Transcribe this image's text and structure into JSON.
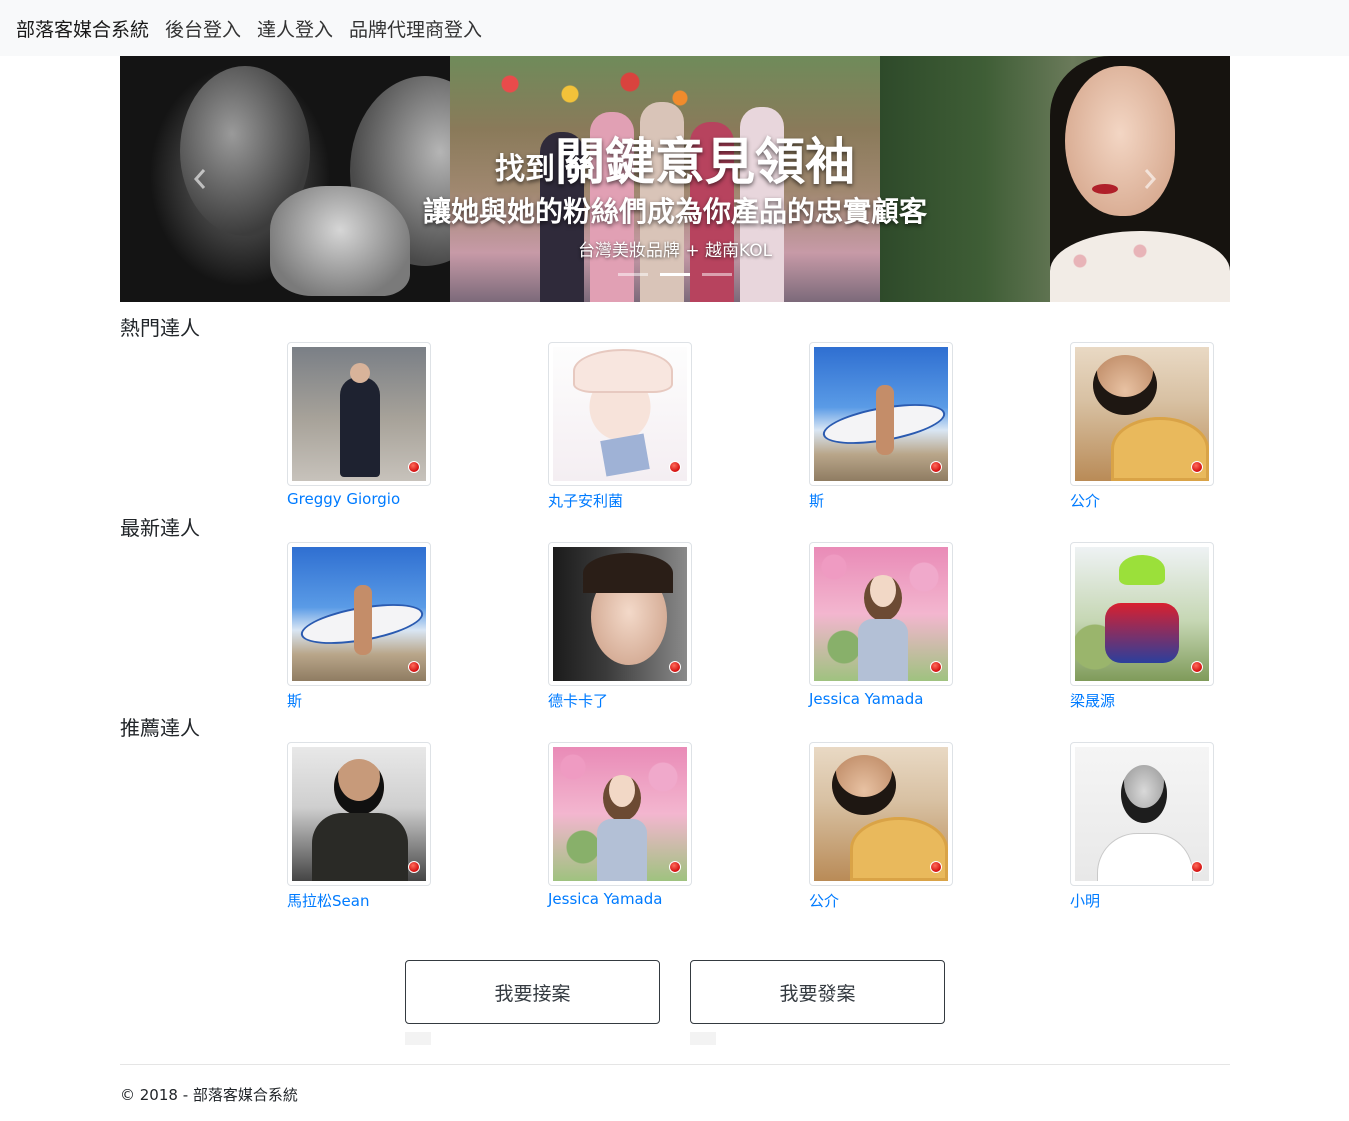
{
  "navbar": {
    "brand": "部落客媒合系統",
    "links": [
      "後台登入",
      "達人登入",
      "品牌代理商登入"
    ]
  },
  "carousel": {
    "title_small": "找到",
    "title_big": "關鍵意見領袖",
    "subtitle": "讓她與她的粉絲們成為你產品的忠實顧客",
    "tagline": "台灣美妝品牌 + 越南KOL",
    "prev_icon": "chevron-left-icon",
    "next_icon": "chevron-right-icon",
    "slide_count": 3,
    "active_index": 1
  },
  "sections": [
    {
      "title": "熱門達人",
      "items": [
        {
          "name": "Greggy Giorgio",
          "art": "city"
        },
        {
          "name": "丸子安利菌",
          "art": "anime"
        },
        {
          "name": "斯",
          "art": "surf"
        },
        {
          "name": "公介",
          "art": "selfie"
        }
      ]
    },
    {
      "title": "最新達人",
      "items": [
        {
          "name": "斯",
          "art": "surf"
        },
        {
          "name": "德卡卡了",
          "art": "car"
        },
        {
          "name": "Jessica Yamada",
          "art": "blossom"
        },
        {
          "name": "梁晟源",
          "art": "cyclist"
        }
      ]
    },
    {
      "title": "推薦達人",
      "items": [
        {
          "name": "馬拉松Sean",
          "art": "runner"
        },
        {
          "name": "Jessica Yamada",
          "art": "blossom"
        },
        {
          "name": "公介",
          "art": "selfie"
        },
        {
          "name": "小明",
          "art": "bw"
        }
      ]
    }
  ],
  "actions": {
    "take_case": "我要接案",
    "post_case": "我要發案"
  },
  "footer": {
    "copyright": "© 2018 - 部落客媒合系統"
  },
  "colors": {
    "link": "#007bff",
    "navbar_bg": "#f8f9fa",
    "badge": "#d20f0f"
  }
}
